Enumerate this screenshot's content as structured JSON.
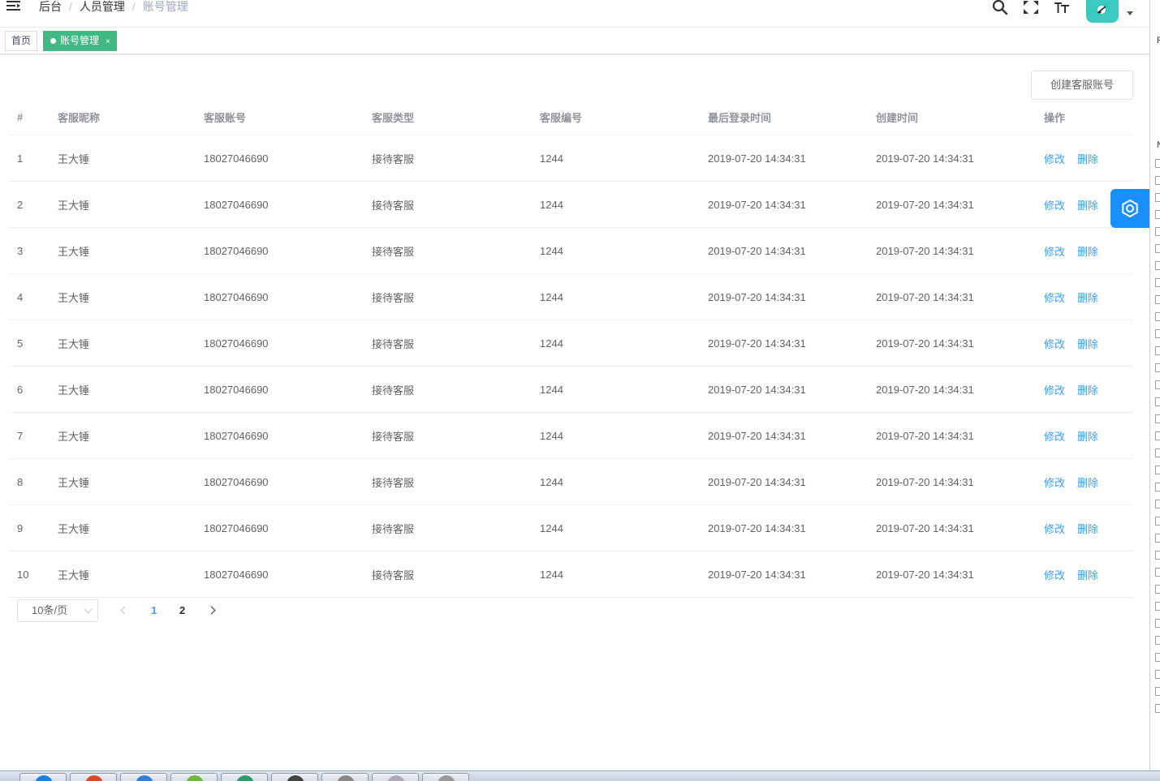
{
  "header": {
    "breadcrumb": [
      "后台",
      "人员管理",
      "账号管理"
    ],
    "icons": [
      "menu-fold-icon",
      "search-icon",
      "fullscreen-icon",
      "font-size-icon",
      "avatar"
    ]
  },
  "tags": {
    "home": "首页",
    "active": "账号管理",
    "close": "×"
  },
  "toolbar": {
    "create_label": "创建客服账号"
  },
  "table": {
    "columns": [
      "#",
      "客服昵称",
      "客服账号",
      "客服类型",
      "客服编号",
      "最后登录时间",
      "创建时间",
      "操作"
    ],
    "rows": [
      {
        "idx": "1",
        "nickname": "王大锤",
        "account": "18027046690",
        "type": "接待客服",
        "code": "1244",
        "last_login": "2019-07-20 14:34:31",
        "created": "2019-07-20 14:34:31",
        "edit": "修改",
        "delete": "删除"
      },
      {
        "idx": "2",
        "nickname": "王大锤",
        "account": "18027046690",
        "type": "接待客服",
        "code": "1244",
        "last_login": "2019-07-20 14:34:31",
        "created": "2019-07-20 14:34:31",
        "edit": "修改",
        "delete": "删除"
      },
      {
        "idx": "3",
        "nickname": "王大锤",
        "account": "18027046690",
        "type": "接待客服",
        "code": "1244",
        "last_login": "2019-07-20 14:34:31",
        "created": "2019-07-20 14:34:31",
        "edit": "修改",
        "delete": "删除"
      },
      {
        "idx": "4",
        "nickname": "王大锤",
        "account": "18027046690",
        "type": "接待客服",
        "code": "1244",
        "last_login": "2019-07-20 14:34:31",
        "created": "2019-07-20 14:34:31",
        "edit": "修改",
        "delete": "删除"
      },
      {
        "idx": "5",
        "nickname": "王大锤",
        "account": "18027046690",
        "type": "接待客服",
        "code": "1244",
        "last_login": "2019-07-20 14:34:31",
        "created": "2019-07-20 14:34:31",
        "edit": "修改",
        "delete": "删除"
      },
      {
        "idx": "6",
        "nickname": "王大锤",
        "account": "18027046690",
        "type": "接待客服",
        "code": "1244",
        "last_login": "2019-07-20 14:34:31",
        "created": "2019-07-20 14:34:31",
        "edit": "修改",
        "delete": "删除"
      },
      {
        "idx": "7",
        "nickname": "王大锤",
        "account": "18027046690",
        "type": "接待客服",
        "code": "1244",
        "last_login": "2019-07-20 14:34:31",
        "created": "2019-07-20 14:34:31",
        "edit": "修改",
        "delete": "删除"
      },
      {
        "idx": "8",
        "nickname": "王大锤",
        "account": "18027046690",
        "type": "接待客服",
        "code": "1244",
        "last_login": "2019-07-20 14:34:31",
        "created": "2019-07-20 14:34:31",
        "edit": "修改",
        "delete": "删除"
      },
      {
        "idx": "9",
        "nickname": "王大锤",
        "account": "18027046690",
        "type": "接待客服",
        "code": "1244",
        "last_login": "2019-07-20 14:34:31",
        "created": "2019-07-20 14:34:31",
        "edit": "修改",
        "delete": "删除"
      },
      {
        "idx": "10",
        "nickname": "王大锤",
        "account": "18027046690",
        "type": "接待客服",
        "code": "1244",
        "last_login": "2019-07-20 14:34:31",
        "created": "2019-07-20 14:34:31",
        "edit": "修改",
        "delete": "删除"
      }
    ]
  },
  "pagination": {
    "page_size": "10条/页",
    "pages": [
      "1",
      "2"
    ],
    "current": "1"
  },
  "side_strip": {
    "letters": [
      "F",
      "N"
    ]
  },
  "colors": {
    "primary": "#409eff",
    "tag_active": "#42b983",
    "settings": "#1890ff",
    "avatar": "#3cc9c0"
  }
}
